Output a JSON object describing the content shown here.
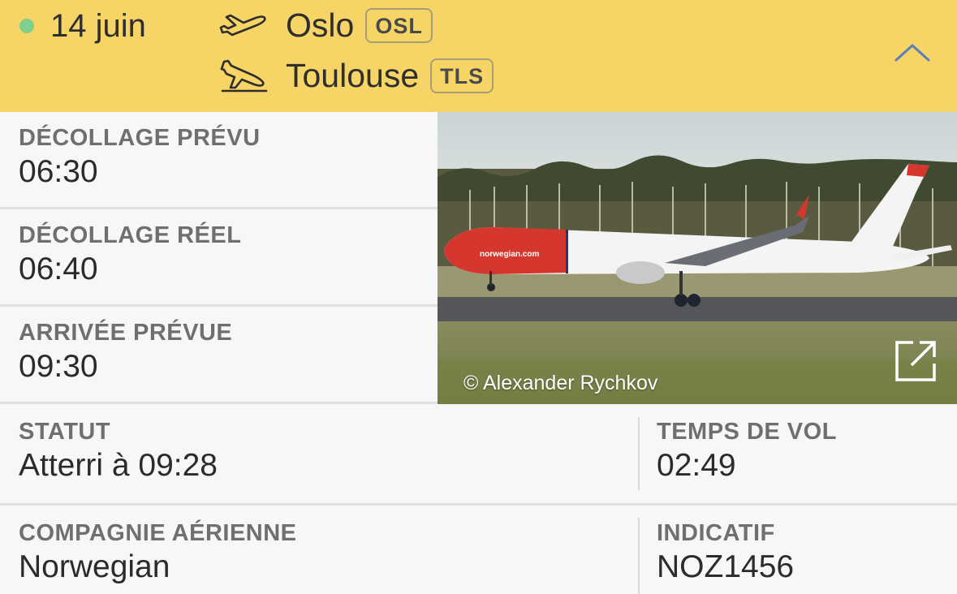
{
  "header": {
    "date": "14 juin",
    "status_color": "#7fd08a",
    "background": "#f6d465",
    "departure": {
      "icon": "takeoff-icon",
      "city": "Oslo",
      "code": "OSL"
    },
    "arrival": {
      "icon": "landing-icon",
      "city": "Toulouse",
      "code": "TLS"
    },
    "collapse_icon": "chevron-up-icon"
  },
  "details": {
    "scheduled_departure": {
      "label": "DÉCOLLAGE PRÉVU",
      "value": "06:30"
    },
    "actual_departure": {
      "label": "DÉCOLLAGE RÉEL",
      "value": "06:40"
    },
    "scheduled_arrival": {
      "label": "ARRIVÉE PRÉVUE",
      "value": "09:30"
    },
    "status": {
      "label": "STATUT",
      "value": "Atterri à 09:28"
    },
    "flight_time": {
      "label": "TEMPS DE VOL",
      "value": "02:49"
    },
    "airline": {
      "label": "COMPAGNIE AÉRIENNE",
      "value": "Norwegian"
    },
    "callsign": {
      "label": "INDICATIF",
      "value": "NOZ1456"
    }
  },
  "photo": {
    "credit": "© Alexander Rychkov",
    "livery_text": "norwegian.com",
    "expand_icon": "external-link-icon"
  }
}
